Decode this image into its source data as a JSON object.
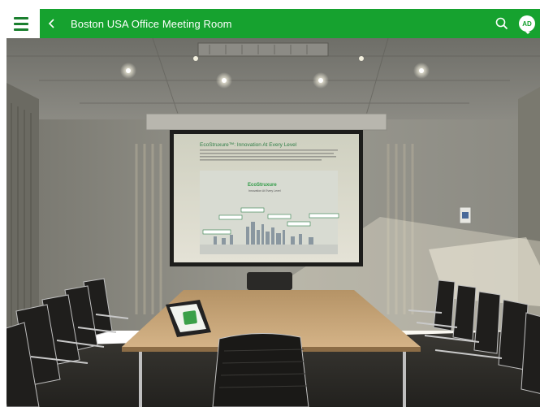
{
  "header": {
    "title": "Boston USA Office Meeting Room",
    "avatar_initials": "AD"
  },
  "icons": {
    "menu": "hamburger-icon",
    "back": "chevron-left-icon",
    "search": "search-icon",
    "avatar_caret": "caret-down-icon"
  },
  "screen": {
    "heading": "EcoStruxure™: Innovation At Every Level",
    "logo_text": "EcoStruxure",
    "tagline": "Innovation At Every Level"
  },
  "colors": {
    "brand": "#16a22f",
    "menu_icon": "#1a7f2e"
  }
}
